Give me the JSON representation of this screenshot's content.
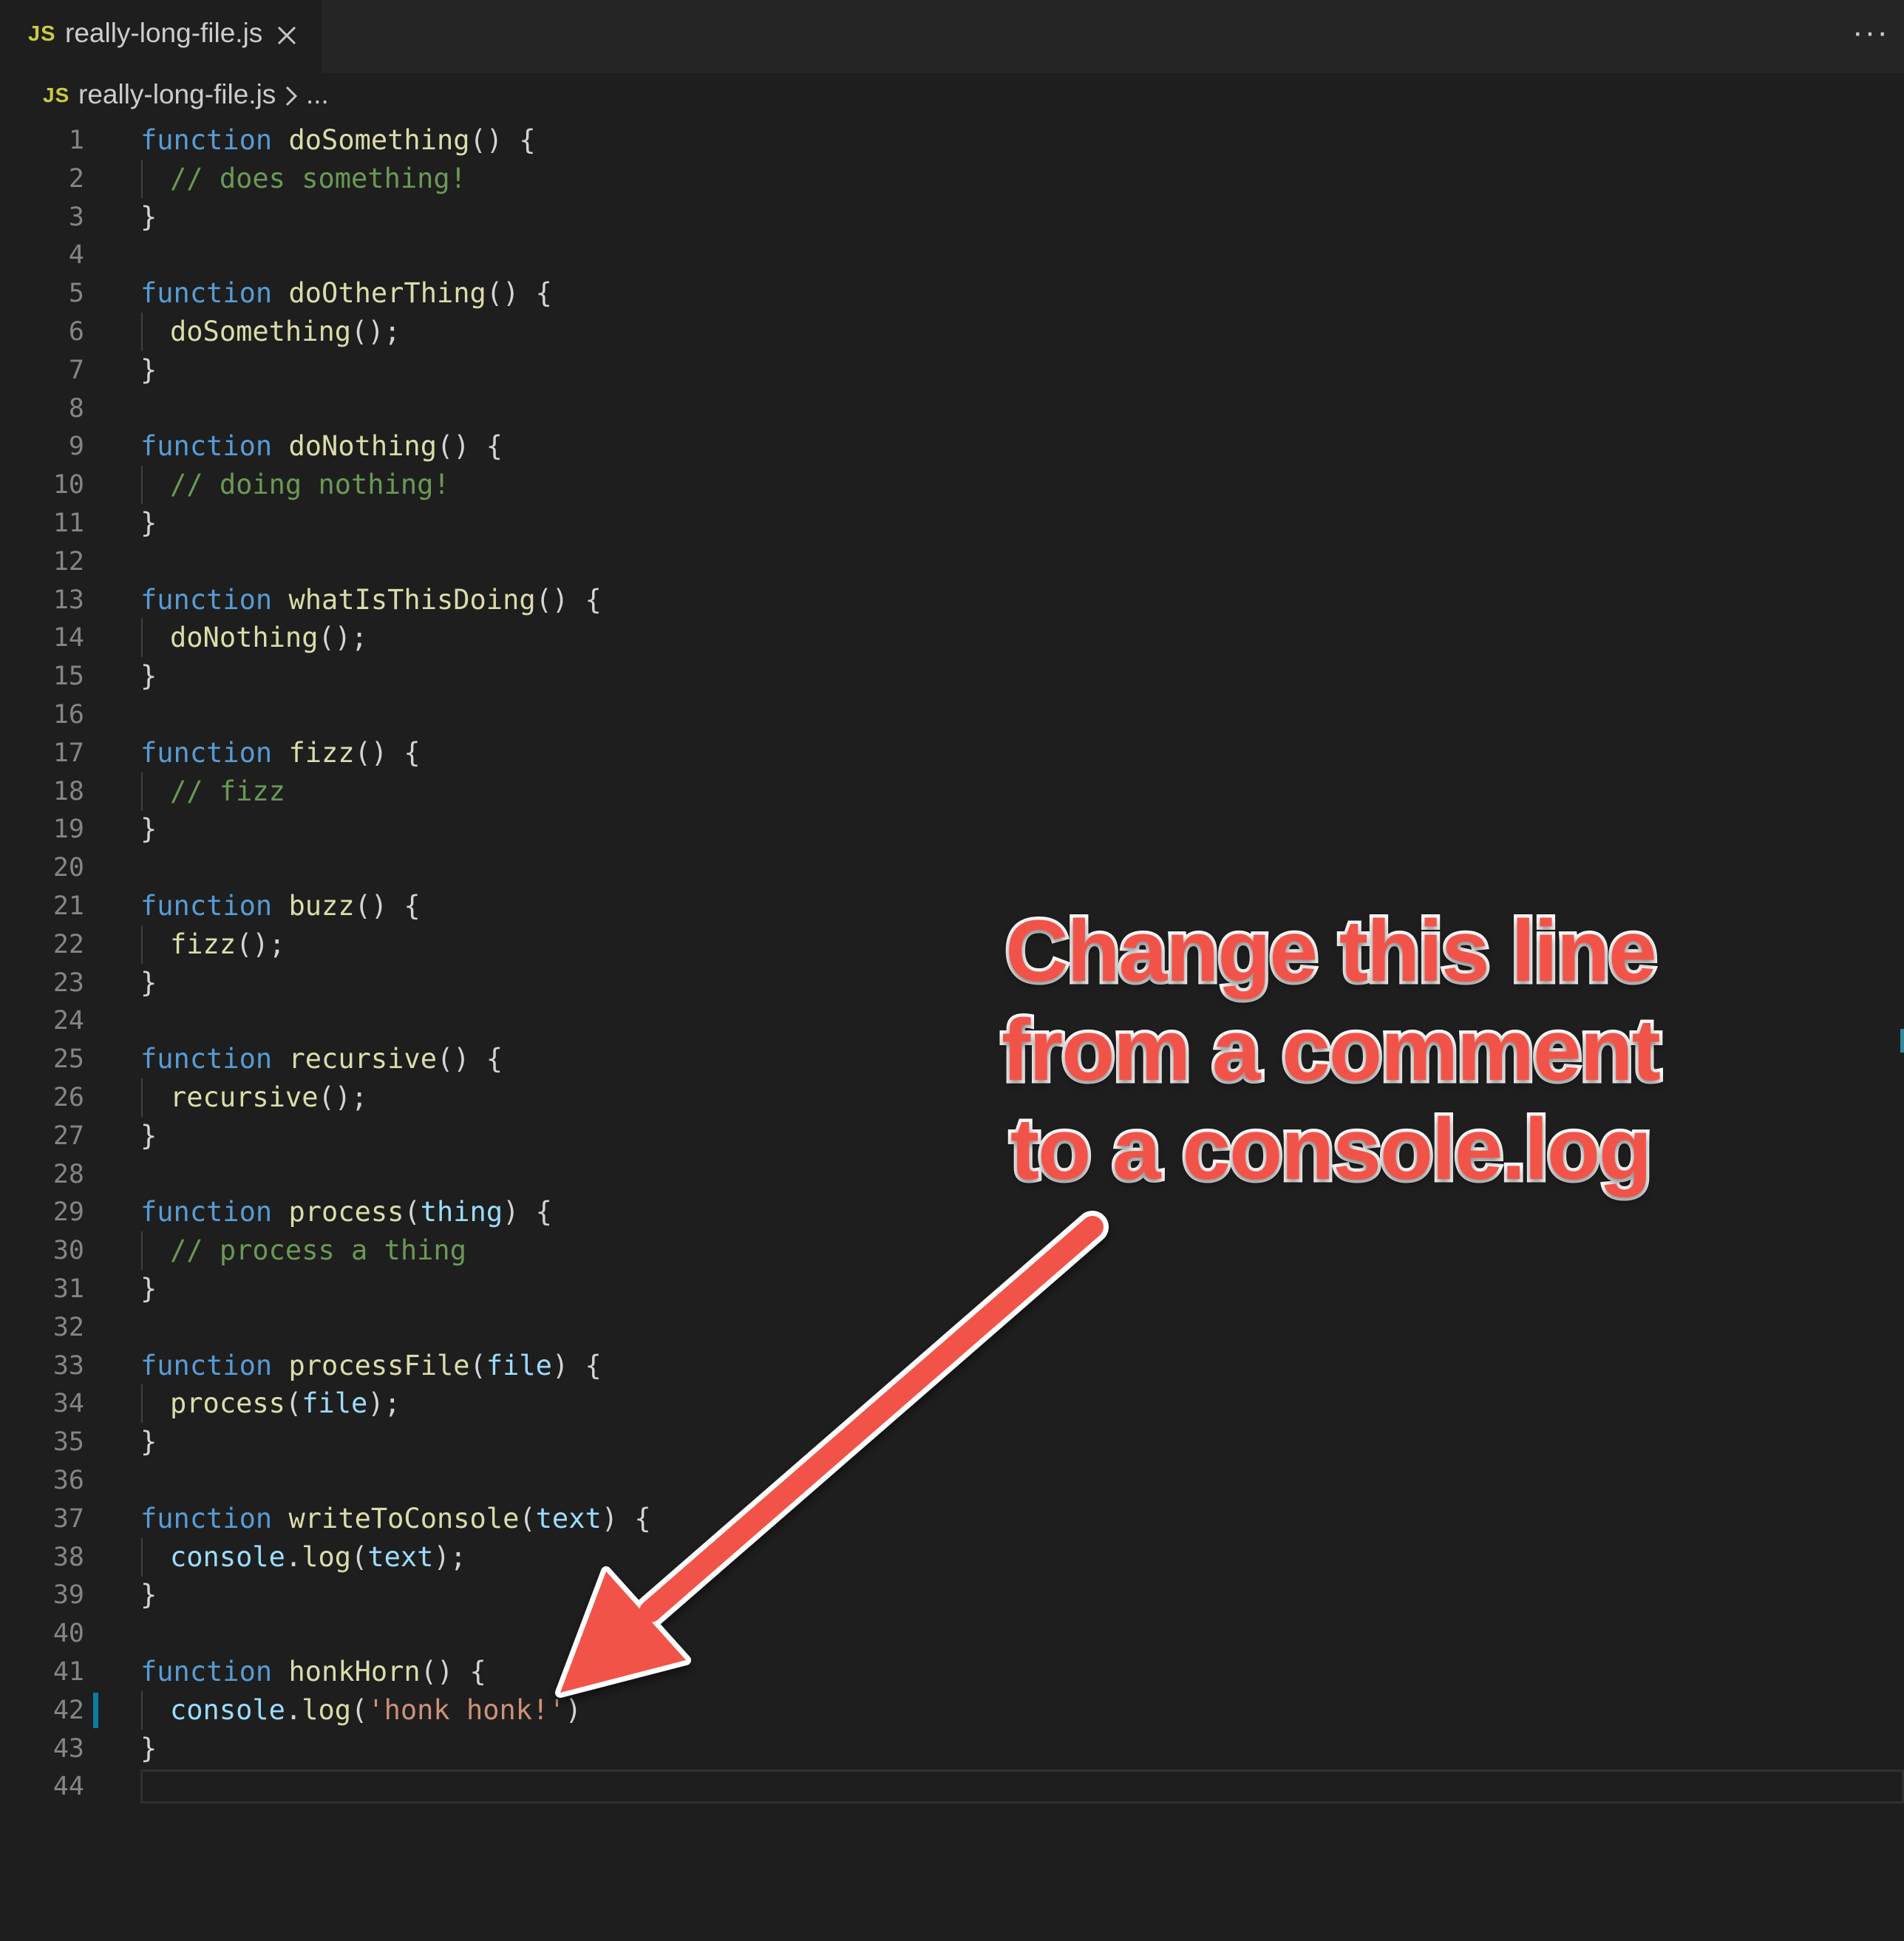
{
  "tab": {
    "icon_label": "JS",
    "title": "really-long-file.js"
  },
  "more_label": "···",
  "breadcrumb": {
    "icon_label": "JS",
    "file": "really-long-file.js",
    "more": "..."
  },
  "lines": [
    {
      "n": "1",
      "tokens": [
        [
          "kw",
          "function"
        ],
        [
          "pu",
          " "
        ],
        [
          "fn",
          "doSomething"
        ],
        [
          "pu",
          "() {"
        ]
      ]
    },
    {
      "n": "2",
      "indent": true,
      "tokens": [
        [
          "cm",
          "// does something!"
        ]
      ]
    },
    {
      "n": "3",
      "tokens": [
        [
          "pu",
          "}"
        ]
      ]
    },
    {
      "n": "4",
      "tokens": []
    },
    {
      "n": "5",
      "tokens": [
        [
          "kw",
          "function"
        ],
        [
          "pu",
          " "
        ],
        [
          "fn",
          "doOtherThing"
        ],
        [
          "pu",
          "() {"
        ]
      ]
    },
    {
      "n": "6",
      "indent": true,
      "tokens": [
        [
          "fn",
          "doSomething"
        ],
        [
          "pu",
          "();"
        ]
      ]
    },
    {
      "n": "7",
      "tokens": [
        [
          "pu",
          "}"
        ]
      ]
    },
    {
      "n": "8",
      "tokens": []
    },
    {
      "n": "9",
      "tokens": [
        [
          "kw",
          "function"
        ],
        [
          "pu",
          " "
        ],
        [
          "fn",
          "doNothing"
        ],
        [
          "pu",
          "() {"
        ]
      ]
    },
    {
      "n": "10",
      "indent": true,
      "tokens": [
        [
          "cm",
          "// doing nothing!"
        ]
      ]
    },
    {
      "n": "11",
      "tokens": [
        [
          "pu",
          "}"
        ]
      ]
    },
    {
      "n": "12",
      "tokens": []
    },
    {
      "n": "13",
      "tokens": [
        [
          "kw",
          "function"
        ],
        [
          "pu",
          " "
        ],
        [
          "fn",
          "whatIsThisDoing"
        ],
        [
          "pu",
          "() {"
        ]
      ]
    },
    {
      "n": "14",
      "indent": true,
      "tokens": [
        [
          "fn",
          "doNothing"
        ],
        [
          "pu",
          "();"
        ]
      ]
    },
    {
      "n": "15",
      "tokens": [
        [
          "pu",
          "}"
        ]
      ]
    },
    {
      "n": "16",
      "tokens": []
    },
    {
      "n": "17",
      "tokens": [
        [
          "kw",
          "function"
        ],
        [
          "pu",
          " "
        ],
        [
          "fn",
          "fizz"
        ],
        [
          "pu",
          "() {"
        ]
      ]
    },
    {
      "n": "18",
      "indent": true,
      "tokens": [
        [
          "cm",
          "// fizz"
        ]
      ]
    },
    {
      "n": "19",
      "tokens": [
        [
          "pu",
          "}"
        ]
      ]
    },
    {
      "n": "20",
      "tokens": []
    },
    {
      "n": "21",
      "tokens": [
        [
          "kw",
          "function"
        ],
        [
          "pu",
          " "
        ],
        [
          "fn",
          "buzz"
        ],
        [
          "pu",
          "() {"
        ]
      ]
    },
    {
      "n": "22",
      "indent": true,
      "tokens": [
        [
          "fn",
          "fizz"
        ],
        [
          "pu",
          "();"
        ]
      ]
    },
    {
      "n": "23",
      "tokens": [
        [
          "pu",
          "}"
        ]
      ]
    },
    {
      "n": "24",
      "tokens": []
    },
    {
      "n": "25",
      "tokens": [
        [
          "kw",
          "function"
        ],
        [
          "pu",
          " "
        ],
        [
          "fn",
          "recursive"
        ],
        [
          "pu",
          "() {"
        ]
      ]
    },
    {
      "n": "26",
      "indent": true,
      "tokens": [
        [
          "fn",
          "recursive"
        ],
        [
          "pu",
          "();"
        ]
      ]
    },
    {
      "n": "27",
      "tokens": [
        [
          "pu",
          "}"
        ]
      ]
    },
    {
      "n": "28",
      "tokens": []
    },
    {
      "n": "29",
      "tokens": [
        [
          "kw",
          "function"
        ],
        [
          "pu",
          " "
        ],
        [
          "fn",
          "process"
        ],
        [
          "pu",
          "("
        ],
        [
          "vr",
          "thing"
        ],
        [
          "pu",
          ") {"
        ]
      ]
    },
    {
      "n": "30",
      "indent": true,
      "tokens": [
        [
          "cm",
          "// process a thing"
        ]
      ]
    },
    {
      "n": "31",
      "tokens": [
        [
          "pu",
          "}"
        ]
      ]
    },
    {
      "n": "32",
      "tokens": []
    },
    {
      "n": "33",
      "tokens": [
        [
          "kw",
          "function"
        ],
        [
          "pu",
          " "
        ],
        [
          "fn",
          "processFile"
        ],
        [
          "pu",
          "("
        ],
        [
          "vr",
          "file"
        ],
        [
          "pu",
          ") {"
        ]
      ]
    },
    {
      "n": "34",
      "indent": true,
      "tokens": [
        [
          "fn",
          "process"
        ],
        [
          "pu",
          "("
        ],
        [
          "vr",
          "file"
        ],
        [
          "pu",
          ");"
        ]
      ]
    },
    {
      "n": "35",
      "tokens": [
        [
          "pu",
          "}"
        ]
      ]
    },
    {
      "n": "36",
      "tokens": []
    },
    {
      "n": "37",
      "tokens": [
        [
          "kw",
          "function"
        ],
        [
          "pu",
          " "
        ],
        [
          "fn",
          "writeToConsole"
        ],
        [
          "pu",
          "("
        ],
        [
          "vr",
          "text"
        ],
        [
          "pu",
          ") {"
        ]
      ]
    },
    {
      "n": "38",
      "indent": true,
      "tokens": [
        [
          "vr",
          "console"
        ],
        [
          "pu",
          "."
        ],
        [
          "fn",
          "log"
        ],
        [
          "pu",
          "("
        ],
        [
          "vr",
          "text"
        ],
        [
          "pu",
          ");"
        ]
      ]
    },
    {
      "n": "39",
      "tokens": [
        [
          "pu",
          "}"
        ]
      ]
    },
    {
      "n": "40",
      "tokens": []
    },
    {
      "n": "41",
      "tokens": [
        [
          "kw",
          "function"
        ],
        [
          "pu",
          " "
        ],
        [
          "fn",
          "honkHorn"
        ],
        [
          "pu",
          "() {"
        ]
      ]
    },
    {
      "n": "42",
      "indent": true,
      "modified": true,
      "tokens": [
        [
          "vr",
          "console"
        ],
        [
          "pu",
          "."
        ],
        [
          "fn",
          "log"
        ],
        [
          "pu",
          "("
        ],
        [
          "st",
          "'honk honk!'"
        ],
        [
          "pu",
          ")"
        ]
      ]
    },
    {
      "n": "43",
      "tokens": [
        [
          "pu",
          "}"
        ]
      ]
    },
    {
      "n": "44",
      "current": true,
      "tokens": []
    }
  ],
  "annotation": {
    "lines": [
      "Change this line",
      "from a comment",
      "to a console.log"
    ],
    "color": "#f25349"
  },
  "colors": {
    "keyword": "#569cd6",
    "function": "#dcdcaa",
    "comment": "#6a9955",
    "string": "#ce9178",
    "variable": "#9cdcfe",
    "modified_marker": "#0c7d9d"
  }
}
